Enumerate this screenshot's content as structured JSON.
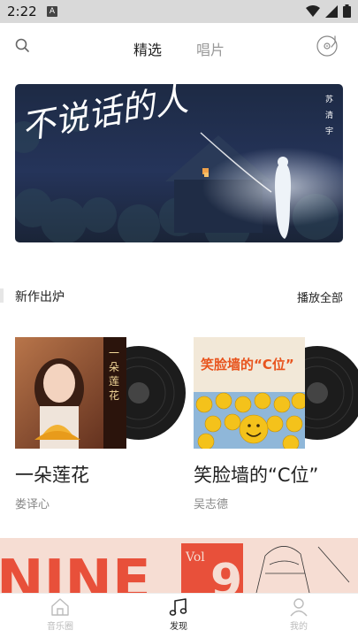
{
  "status_bar": {
    "time": "2:22",
    "notification_letter": "A"
  },
  "header": {
    "tabs": [
      {
        "label": "精选",
        "active": true
      },
      {
        "label": "唱片",
        "active": false
      }
    ]
  },
  "banner": {
    "title_art": "不说话的人",
    "artist_vertical": [
      "苏",
      "清",
      "宇"
    ]
  },
  "section": {
    "title": "新作出炉",
    "play_all": "播放全部"
  },
  "albums": [
    {
      "title": "一朵莲花",
      "artist": "娄译心",
      "cover_text": [
        "一",
        "朵",
        "莲",
        "花"
      ]
    },
    {
      "title": "笑脸墙的“C位”",
      "artist": "吴志德",
      "cover_text": "笑脸墙的“C位”"
    }
  ],
  "promo": {
    "text": "NINE",
    "vol": "Vol",
    "number": "9"
  },
  "bottom_nav": [
    {
      "label": "音乐圈",
      "icon": "home-icon",
      "active": false
    },
    {
      "label": "发现",
      "icon": "music-note-icon",
      "active": true
    },
    {
      "label": "我的",
      "icon": "person-icon",
      "active": false
    }
  ],
  "colors": {
    "accent": "#222222",
    "inactive": "#999999",
    "promo_red": "#e74c3c"
  }
}
